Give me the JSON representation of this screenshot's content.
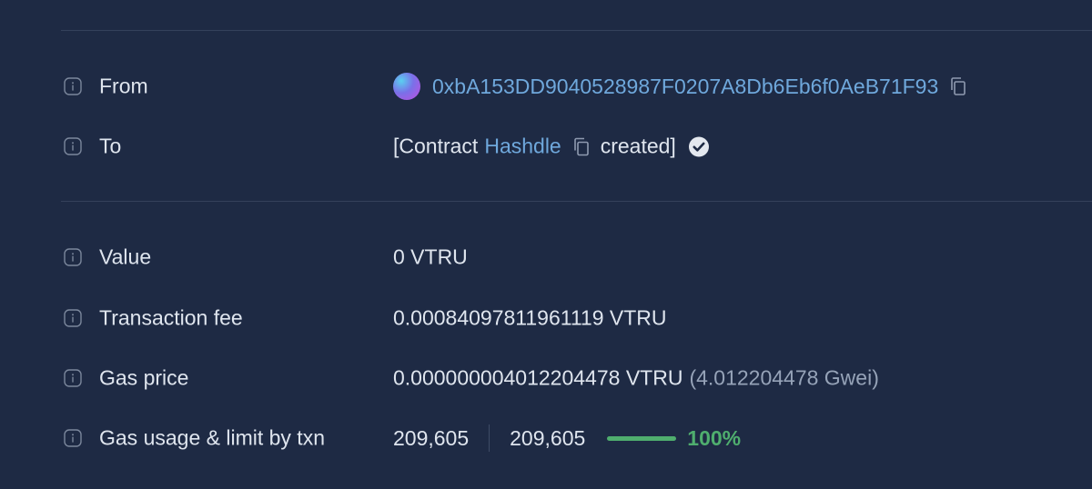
{
  "rows": {
    "from": {
      "label": "From",
      "address": "0xbA153DD9040528987F0207A8Db6Eb6f0AeB71F93"
    },
    "to": {
      "label": "To",
      "prefix": "[Contract",
      "contract_name": "Hashdle",
      "suffix": "created]"
    },
    "value": {
      "label": "Value",
      "amount": "0 VTRU"
    },
    "fee": {
      "label": "Transaction fee",
      "amount": "0.00084097811961119 VTRU"
    },
    "gas_price": {
      "label": "Gas price",
      "amount": "0.000000004012204478 VTRU",
      "gwei": "(4.012204478 Gwei)"
    },
    "gas_usage": {
      "label": "Gas usage & limit by txn",
      "usage": "209,605",
      "limit": "209,605",
      "percent_text": "100%",
      "percent": 100
    }
  },
  "colors": {
    "background": "#1e2a44",
    "link": "#6fa8dc",
    "success": "#4fae6e"
  },
  "icons": {
    "info": "info-icon",
    "copy": "copy-icon",
    "verified": "check-circle-icon"
  }
}
